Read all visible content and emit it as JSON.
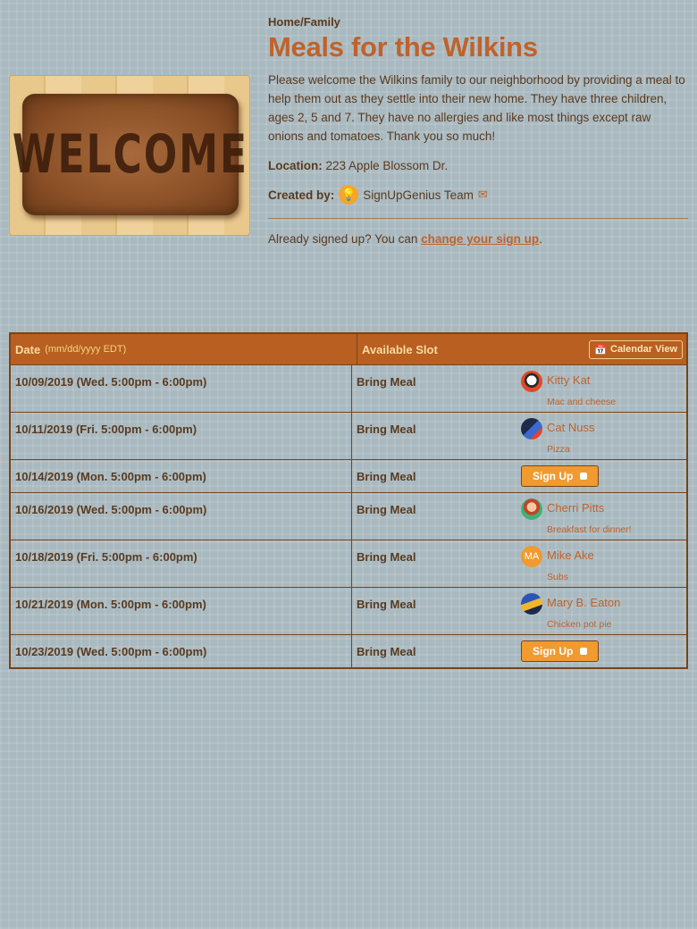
{
  "breadcrumb": "Home/Family",
  "title": "Meals for the Wilkins",
  "image": {
    "text": "WELCOME"
  },
  "description": "Please welcome the Wilkins family to our neighborhood by providing a meal to help them out as they settle into their new home. They have three children, ages 2, 5 and 7. They have no allergies and like most things except raw onions and tomatoes. Thank you so much!",
  "location": {
    "label": "Location:",
    "value": "223 Apple Blossom Dr."
  },
  "creator": {
    "label": "Created by:",
    "name": "SignUpGenius Team"
  },
  "already": {
    "text": "Already signed up? You can ",
    "link": "change your sign up",
    "suffix": "."
  },
  "table": {
    "date_header": "Date",
    "date_format": "(mm/dd/yyyy EDT)",
    "slot_header": "Available Slot",
    "calendar_button": "Calendar View",
    "rows": [
      {
        "date": "10/09/2019 (Wed. 5:00pm - 6:00pm)",
        "slot": "Bring Meal",
        "name": "Kitty Kat",
        "note": "Mac and cheese"
      },
      {
        "date": "10/11/2019 (Fri. 5:00pm - 6:00pm)",
        "slot": "Bring Meal",
        "name": "Cat Nuss",
        "note": "Pizza"
      },
      {
        "date": "10/14/2019 (Mon. 5:00pm - 6:00pm)",
        "slot": "Bring Meal",
        "signup": "Sign Up"
      },
      {
        "date": "10/16/2019 (Wed. 5:00pm - 6:00pm)",
        "slot": "Bring Meal",
        "name": "Cherri Pitts",
        "note": "Breakfast for dinner!"
      },
      {
        "date": "10/18/2019 (Fri. 5:00pm - 6:00pm)",
        "slot": "Bring Meal",
        "name": "Mike Ake",
        "note": "Subs",
        "initials": "MA"
      },
      {
        "date": "10/21/2019 (Mon. 5:00pm - 6:00pm)",
        "slot": "Bring Meal",
        "name": "Mary B. Eaton",
        "note": "Chicken pot pie"
      },
      {
        "date": "10/23/2019 (Wed. 5:00pm - 6:00pm)",
        "slot": "Bring Meal",
        "signup": "Sign Up"
      }
    ]
  },
  "colors": {
    "accent": "#c0622a",
    "header": "#b95f22",
    "button": "#f09a2f",
    "background": "#a9b9c0"
  }
}
